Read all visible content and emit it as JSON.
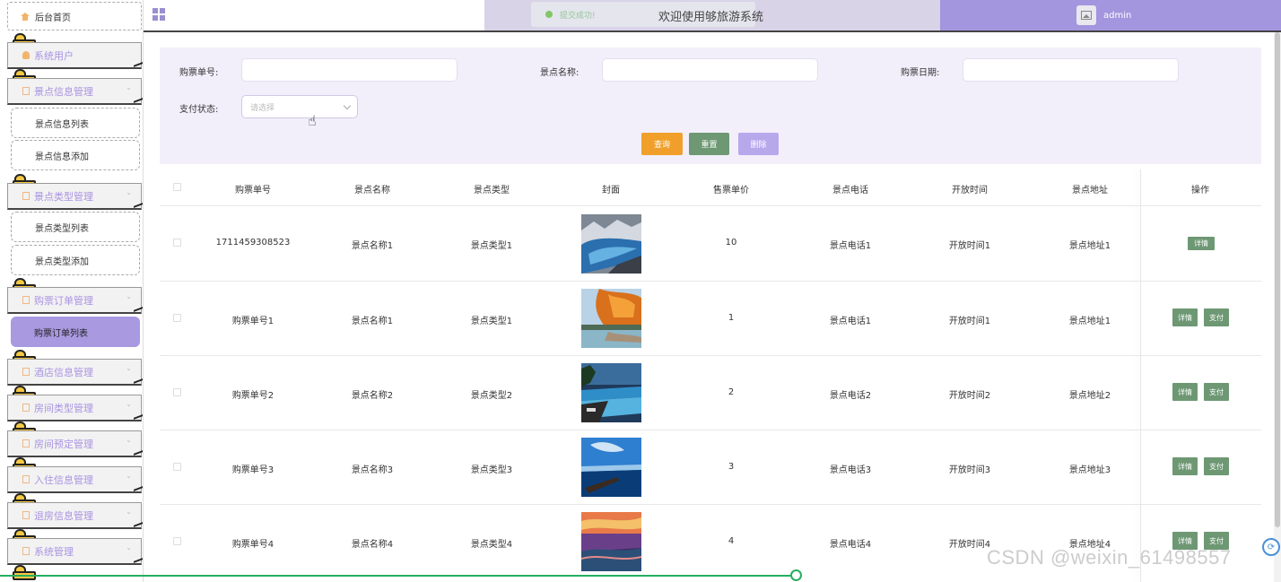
{
  "sidebar": {
    "home": "后台首页",
    "groups": [
      {
        "label": "系统用户"
      },
      {
        "label": "景点信息管理",
        "items": [
          "景点信息列表",
          "景点信息添加"
        ]
      },
      {
        "label": "景点类型管理",
        "items": [
          "景点类型列表",
          "景点类型添加"
        ]
      },
      {
        "label": "购票订单管理",
        "items": [
          "购票订单列表"
        ]
      },
      {
        "label": "酒店信息管理"
      },
      {
        "label": "房间类型管理"
      },
      {
        "label": "房间预定管理"
      },
      {
        "label": "入住信息管理"
      },
      {
        "label": "退房信息管理"
      },
      {
        "label": "系统管理"
      }
    ],
    "active_item": "购票订单列表"
  },
  "header": {
    "toast": "提交成功!",
    "welcome": "欢迎使用够旅游系统",
    "username": "admin"
  },
  "filter": {
    "ticket_no_label": "购票单号:",
    "spot_name_label": "景点名称:",
    "date_label": "购票日期:",
    "pay_status_label": "支付状态:",
    "pay_status_placeholder": "请选择",
    "query": "查询",
    "reset": "重置",
    "delete": "删除"
  },
  "table": {
    "headers": [
      "购票单号",
      "景点名称",
      "景点类型",
      "封面",
      "售票单价",
      "景点电话",
      "开放时间",
      "景点地址",
      "操作"
    ],
    "detail_label": "详情",
    "pay_label": "支付",
    "rows": [
      {
        "no": "1711459308523",
        "name": "景点名称1",
        "type": "景点类型1",
        "price": "10",
        "phone": "景点电话1",
        "time": "开放时间1",
        "addr": "景点地址1",
        "thumb": "lake-mountain-icon",
        "pay": false
      },
      {
        "no": "购票单号1",
        "name": "景点名称1",
        "type": "景点类型1",
        "price": "1",
        "phone": "景点电话1",
        "time": "开放时间1",
        "addr": "景点地址1",
        "thumb": "autumn-lake-icon",
        "pay": true
      },
      {
        "no": "购票单号2",
        "name": "景点名称2",
        "type": "景点类型2",
        "price": "2",
        "phone": "景点电话2",
        "time": "开放时间2",
        "addr": "景点地址2",
        "thumb": "resort-pool-icon",
        "pay": true
      },
      {
        "no": "购票单号3",
        "name": "景点名称3",
        "type": "景点类型3",
        "price": "3",
        "phone": "景点电话3",
        "time": "开放时间3",
        "addr": "景点地址3",
        "thumb": "blue-sea-icon",
        "pay": true
      },
      {
        "no": "购票单号4",
        "name": "景点名称4",
        "type": "景点类型4",
        "price": "4",
        "phone": "景点电话4",
        "time": "开放时间4",
        "addr": "景点地址4",
        "thumb": "sunset-terrace-icon",
        "pay": true
      }
    ]
  },
  "colors": {
    "accent": "#a396de",
    "query": "#f0a02a",
    "reset": "#6d9873",
    "delete": "#b7a8ec",
    "action": "#6d9873"
  },
  "watermark": "CSDN @weixin_61498557"
}
